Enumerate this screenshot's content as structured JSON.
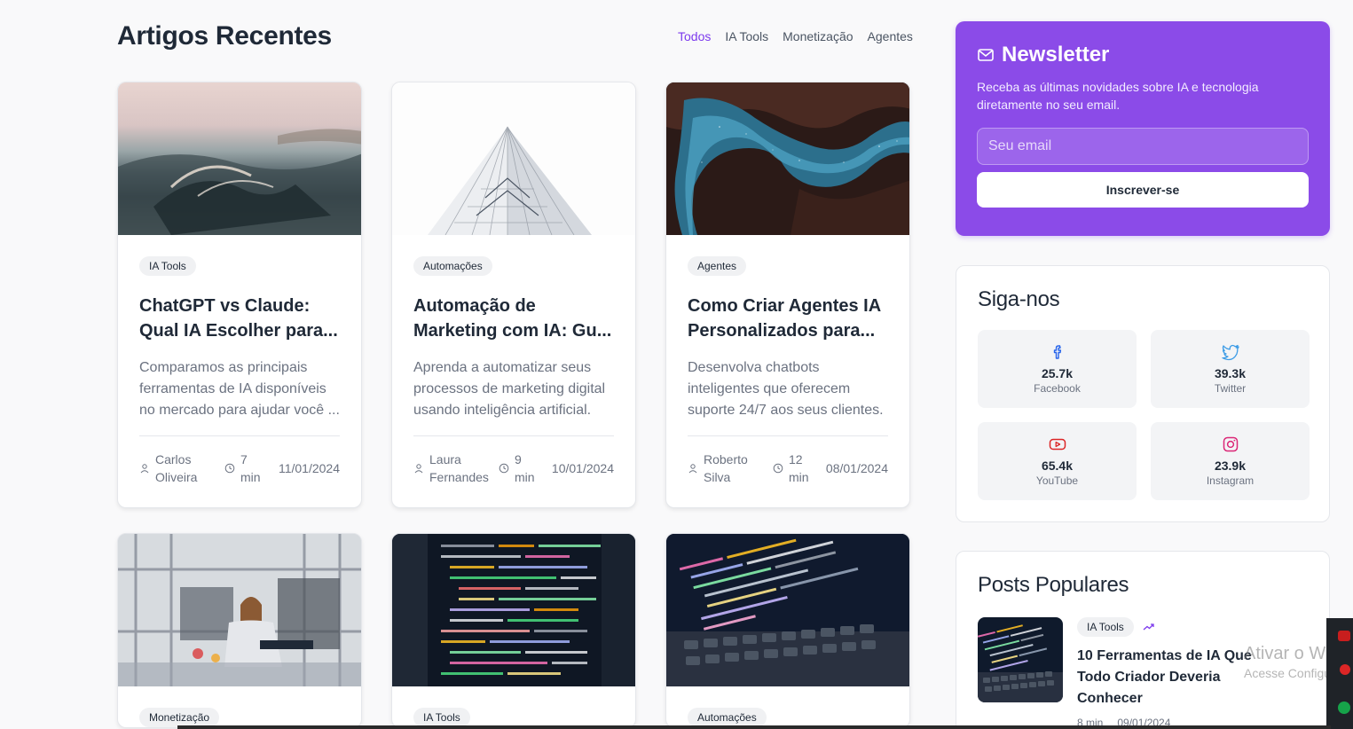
{
  "section": {
    "title": "Artigos Recentes",
    "filters": [
      "Todos",
      "IA Tools",
      "Monetização",
      "Agentes"
    ]
  },
  "colors": {
    "accent": "#7c3aed",
    "newsletter_bg": "#8b4be8"
  },
  "articles": [
    {
      "tag": "IA Tools",
      "title": "ChatGPT vs Claude: Qual IA Escolher para...",
      "excerpt": "Comparamos as principais ferramentas de IA disponíveis no mercado para ajudar você ...",
      "author": "Carlos Oliveira",
      "read_time": "7 min",
      "date": "11/01/2024"
    },
    {
      "tag": "Automações",
      "title": "Automação de Marketing com IA: Gu...",
      "excerpt": "Aprenda a automatizar seus processos de marketing digital usando inteligência artificial.",
      "author": "Laura Fernandes",
      "read_time": "9 min",
      "date": "10/01/2024"
    },
    {
      "tag": "Agentes",
      "title": "Como Criar Agentes IA Personalizados para...",
      "excerpt": "Desenvolva chatbots inteligentes que oferecem suporte 24/7 aos seus clientes.",
      "author": "Roberto Silva",
      "read_time": "12 min",
      "date": "08/01/2024"
    },
    {
      "tag": "Monetização"
    },
    {
      "tag": "IA Tools"
    },
    {
      "tag": "Automações"
    }
  ],
  "newsletter": {
    "title": "Newsletter",
    "description": "Receba as últimas novidades sobre IA e tecnologia diretamente no seu email.",
    "email_placeholder": "Seu email",
    "button_label": "Inscrever-se"
  },
  "social": {
    "title": "Siga-nos",
    "items": [
      {
        "icon": "facebook-icon",
        "count": "25.7k",
        "name": "Facebook",
        "color": "#2563eb"
      },
      {
        "icon": "twitter-icon",
        "count": "39.3k",
        "name": "Twitter",
        "color": "#3b9be6"
      },
      {
        "icon": "youtube-icon",
        "count": "65.4k",
        "name": "YouTube",
        "color": "#dc2626"
      },
      {
        "icon": "instagram-icon",
        "count": "23.9k",
        "name": "Instagram",
        "color": "#db2777"
      }
    ]
  },
  "popular": {
    "title": "Posts Populares",
    "items": [
      {
        "tag": "IA Tools",
        "title": "10 Ferramentas de IA Que Todo Criador Deveria Conhecer",
        "read_time": "8 min",
        "date": "09/01/2024",
        "icon": "trending-icon"
      }
    ]
  },
  "os_overlay": {
    "line1": "Ativar o Windows",
    "line2": "Acesse Configurações"
  }
}
